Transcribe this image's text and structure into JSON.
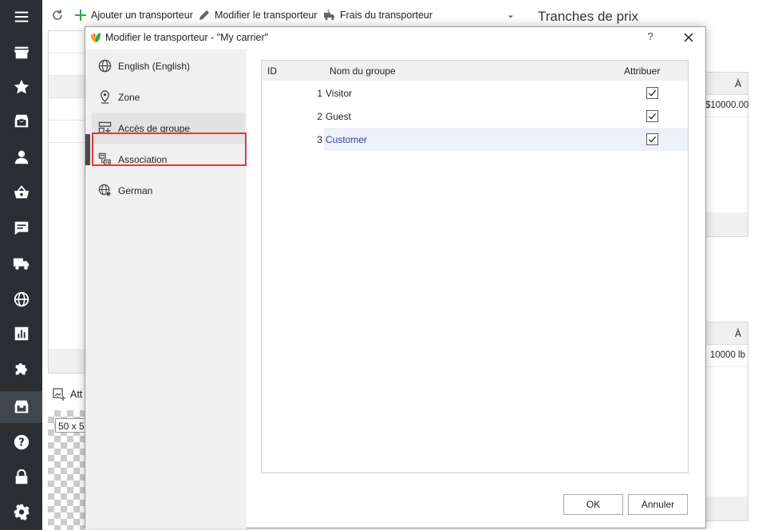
{
  "nav": {
    "items": [
      "menu-icon",
      "store-icon",
      "star-icon",
      "inbox-icon",
      "user-icon",
      "basket-icon",
      "message-icon",
      "truck-icon",
      "globe-icon",
      "chart-icon",
      "puzzle-icon",
      "archive-icon",
      "help-icon",
      "lock-icon",
      "gear-icon"
    ],
    "active_index": 11
  },
  "toolbar": {
    "refresh": "refresh-icon",
    "add_label": "Ajouter un transporteur",
    "edit_label": "Modifier le transporteur",
    "fees_label": "Frais du transporteur",
    "panel_title": "Tranches de prix"
  },
  "background": {
    "price_col": "À",
    "price_value": "$10000.00",
    "weight_col": "À",
    "weight_value": "10000 lb",
    "attach_label": "Att",
    "image_size": "50 x 5"
  },
  "dialog": {
    "title": "Modifier le transporteur - \"My carrier\"",
    "help": "?",
    "sidebar": [
      {
        "label": "English (English)",
        "icon": "globe-icon"
      },
      {
        "label": "Zone",
        "icon": "location-pin-icon"
      },
      {
        "label": "Accès de groupe",
        "icon": "group-add-icon"
      },
      {
        "label": "Association",
        "icon": "association-icon"
      },
      {
        "label": "German",
        "icon": "globe-settings-icon"
      }
    ],
    "active_sidebar": 2,
    "grid": {
      "columns": {
        "id": "ID",
        "name": "Nom du groupe",
        "assign": "Attribuer"
      },
      "rows": [
        {
          "id": "1",
          "name": "Visitor",
          "checked": true
        },
        {
          "id": "2",
          "name": "Guest",
          "checked": true
        },
        {
          "id": "3",
          "name": "Customer",
          "checked": true
        }
      ],
      "selected_row": 2
    },
    "ok_label": "OK",
    "cancel_label": "Annuler"
  },
  "colors": {
    "nav_bg": "#2b2f33",
    "highlight": "#e0393e",
    "link": "#3a3aa0",
    "add_green": "#2ea84a"
  }
}
